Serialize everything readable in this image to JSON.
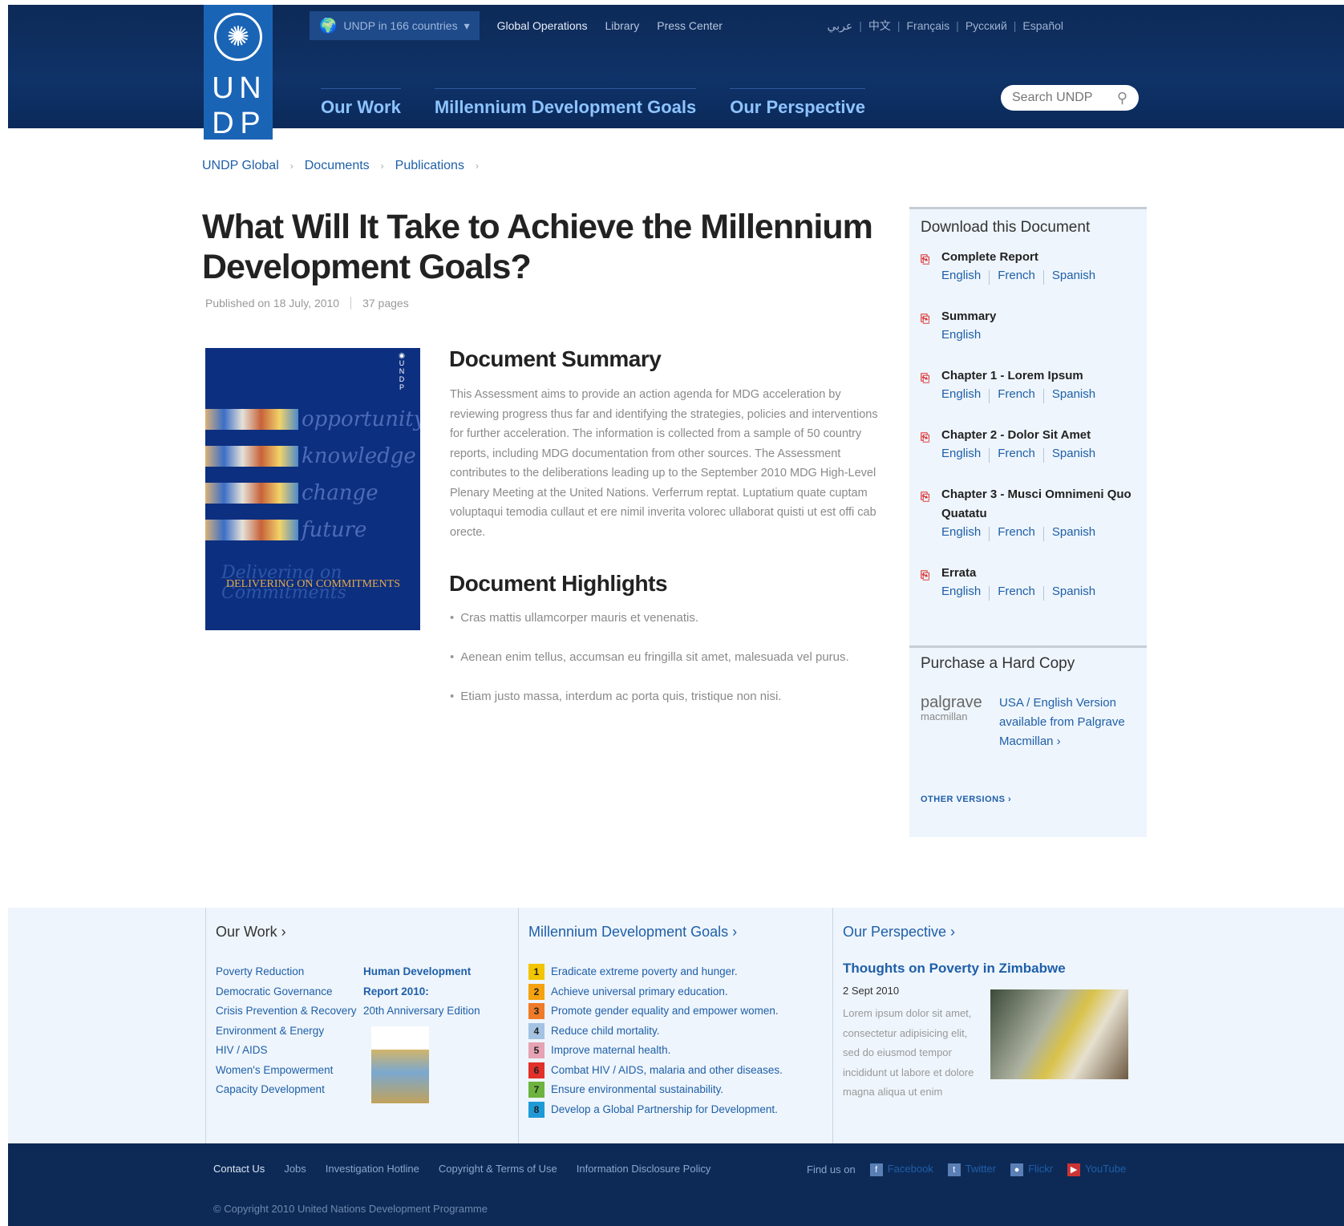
{
  "header": {
    "logo_letters": [
      "U",
      "N",
      "D",
      "P"
    ],
    "countries_label": "UNDP in 166 countries",
    "top_links": [
      "Global Operations",
      "Library",
      "Press Center"
    ],
    "languages": [
      "عربي",
      "中文",
      "Français",
      "Русский",
      "Español"
    ],
    "main_nav": [
      "Our Work",
      "Millennium Development Goals",
      "Our Perspective"
    ],
    "search_placeholder": "Search UNDP"
  },
  "breadcrumb": [
    "UNDP Global",
    "Documents",
    "Publications"
  ],
  "article": {
    "title": "What Will It Take to Achieve the Millennium Development Goals?",
    "published": "Published on 18 July, 2010",
    "pages": "37 pages",
    "cover_words": [
      "opportunity",
      "knowledge",
      "change",
      "future"
    ],
    "cover_script": "Delivering on Commitments",
    "cover_title": "DELIVERING ON COMMITMENTS",
    "summary_heading": "Document Summary",
    "summary_text": "This Assessment aims to provide an action agenda for MDG acceleration by reviewing progress thus far and identifying the strategies, policies and interventions for further acceleration. The information is collected from a sample of 50 country reports, including MDG documentation from other sources. The Assessment contributes to the deliberations leading up to the September 2010 MDG High-Level Plenary Meeting at the United Nations. Verferrum reptat. Luptatium quate cuptam voluptaqui temodia cullaut et ere nimil inverita volorec ullaborat quisti ut est offi cab orecte.",
    "highlights_heading": "Document Highlights",
    "highlights": [
      "Cras mattis ullamcorper mauris et venenatis.",
      "Aenean enim tellus, accumsan eu fringilla sit amet, malesuada vel purus.",
      "Etiam justo massa, interdum ac porta quis, tristique non nisi."
    ]
  },
  "download": {
    "title": "Download this Document",
    "items": [
      {
        "name": "Complete Report",
        "langs": [
          "English",
          "French",
          "Spanish"
        ]
      },
      {
        "name": "Summary",
        "langs": [
          "English"
        ]
      },
      {
        "name": "Chapter 1 - Lorem Ipsum",
        "langs": [
          "English",
          "French",
          "Spanish"
        ]
      },
      {
        "name": "Chapter 2 - Dolor Sit Amet",
        "langs": [
          "English",
          "French",
          "Spanish"
        ]
      },
      {
        "name": "Chapter 3 - Musci Omnimeni Quo Quatatu",
        "langs": [
          "English",
          "French",
          "Spanish"
        ]
      },
      {
        "name": "Errata",
        "langs": [
          "English",
          "French",
          "Spanish"
        ]
      }
    ],
    "purchase_title": "Purchase a Hard Copy",
    "palgrave": "palgrave",
    "macmillan": "macmillan",
    "purchase_link": "USA / English Version available from Palgrave Macmillan ›",
    "other_versions": "OTHER VERSIONS ›"
  },
  "footer": {
    "our_work_heading": "Our Work ›",
    "our_work_links": [
      "Poverty Reduction",
      "Democratic Governance",
      "Crisis Prevention & Recovery",
      "Environment & Energy",
      "HIV / AIDS",
      "Women's Empowerment",
      "Capacity Development"
    ],
    "hdr_title": "Human Development Report 2010:",
    "hdr_edition": "20th Anniversary Edition",
    "mdg_heading": "Millennium Development Goals ›",
    "mdg_goals": [
      {
        "n": "1",
        "text": "Eradicate extreme poverty and hunger.",
        "color": "#f2c500"
      },
      {
        "n": "2",
        "text": "Achieve universal primary education.",
        "color": "#f4a20d"
      },
      {
        "n": "3",
        "text": "Promote gender equality and empower women.",
        "color": "#ef7a27"
      },
      {
        "n": "4",
        "text": "Reduce child mortality.",
        "color": "#a4c3e3"
      },
      {
        "n": "5",
        "text": "Improve maternal health.",
        "color": "#e5a3b4"
      },
      {
        "n": "6",
        "text": "Combat HIV / AIDS, malaria and other diseases.",
        "color": "#e2302a"
      },
      {
        "n": "7",
        "text": "Ensure environmental sustainability.",
        "color": "#6db33f"
      },
      {
        "n": "8",
        "text": "Develop a Global Partnership for Development.",
        "color": "#1f9ad7"
      }
    ],
    "perspective_heading": "Our Perspective ›",
    "article_title": "Thoughts on Poverty in Zimbabwe",
    "article_date": "2 Sept 2010",
    "article_body": "Lorem ipsum dolor sit amet, consectetur adipisicing elit, sed do eiusmod tempor incididunt ut labore et dolore magna aliqua ut enim"
  },
  "bottom": {
    "links": [
      "Contact Us",
      "Jobs",
      "Investigation Hotline",
      "Copyright & Terms of Use",
      "Information Disclosure Policy"
    ],
    "find_us": "Find us on",
    "social": [
      "Facebook",
      "Twitter",
      "Flickr",
      "YouTube"
    ],
    "copyright": "© Copyright 2010 United Nations Development Programme"
  }
}
